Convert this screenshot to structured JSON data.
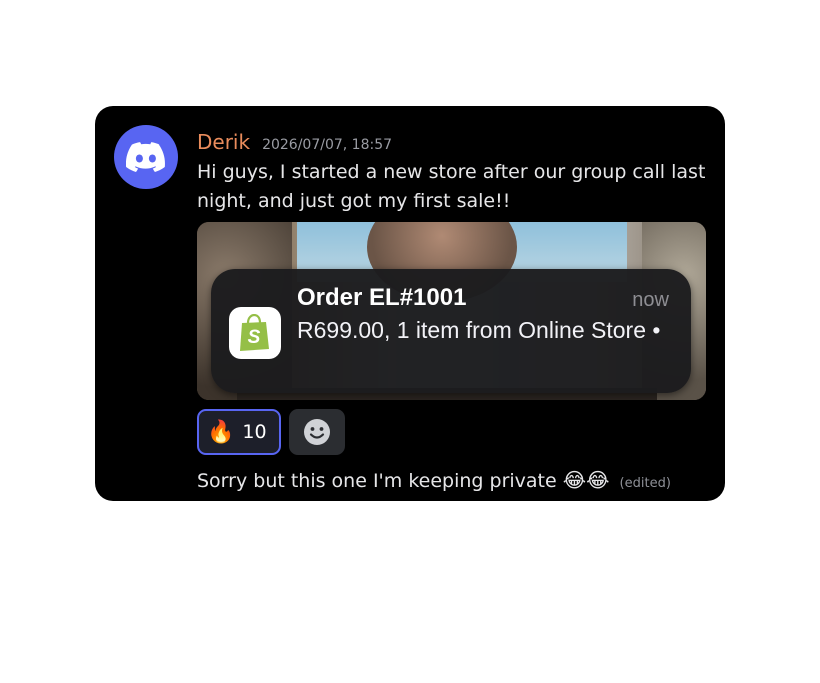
{
  "message": {
    "username": "Derik",
    "timestamp": "2026/07/07, 18:57",
    "text": "Hi guys, I started a new store after our group call last night, and just got my first sale!!"
  },
  "notification": {
    "title": "Order EL#1001",
    "time": "now",
    "body": "R699.00, 1 item from Online Store •"
  },
  "reactions": [
    {
      "emoji": "🔥",
      "count": "10"
    }
  ],
  "followup": {
    "text": "Sorry but this one I'm keeping private",
    "emoji": "😂😂",
    "edited": "(edited)"
  },
  "colors": {
    "accent": "#5865f2",
    "username": "#e98c5c",
    "shopify": "#95bf47"
  }
}
